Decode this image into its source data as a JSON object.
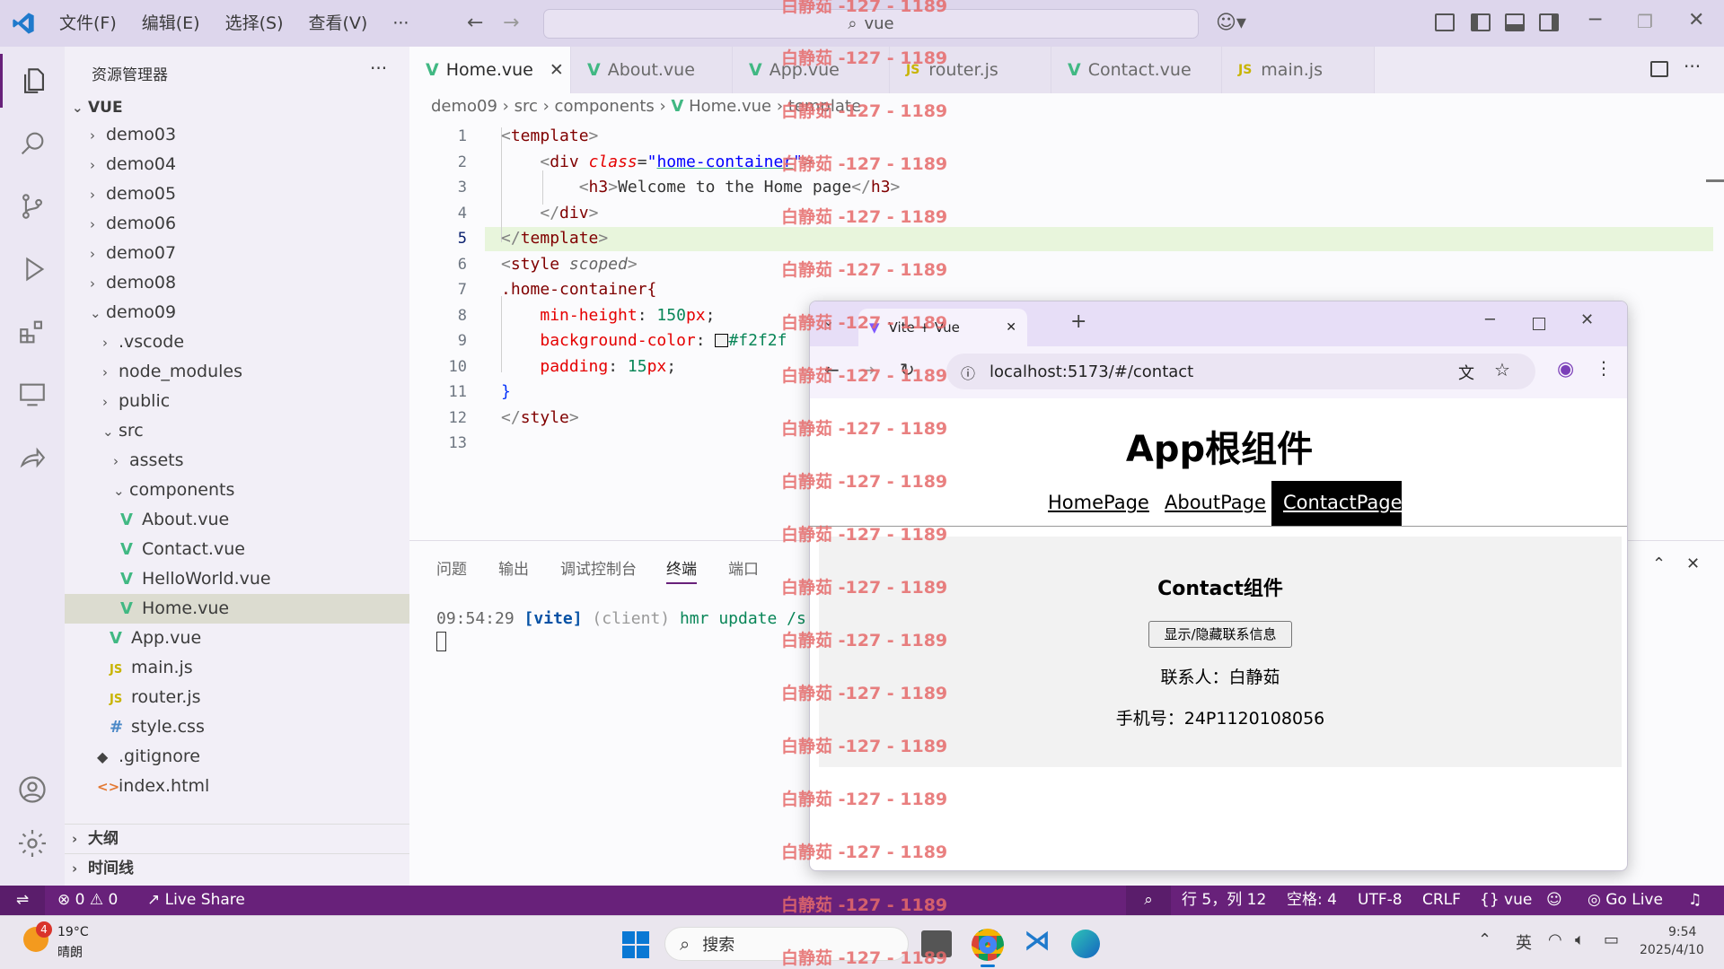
{
  "titlebar": {
    "menus": [
      "文件(F)",
      "编辑(E)",
      "选择(S)",
      "查看(V)",
      "···"
    ],
    "search": "vue"
  },
  "sidebar": {
    "title": "资源管理器",
    "more": "···",
    "root": "VUE",
    "items": [
      {
        "label": "demo03"
      },
      {
        "label": "demo04"
      },
      {
        "label": "demo05"
      },
      {
        "label": "demo06"
      },
      {
        "label": "demo07"
      },
      {
        "label": "demo08"
      },
      {
        "label": "demo09"
      },
      {
        "label": ".vscode"
      },
      {
        "label": "node_modules"
      },
      {
        "label": "public"
      },
      {
        "label": "src"
      },
      {
        "label": "assets"
      },
      {
        "label": "components"
      },
      {
        "label": "About.vue"
      },
      {
        "label": "Contact.vue"
      },
      {
        "label": "HelloWorld.vue"
      },
      {
        "label": "Home.vue"
      },
      {
        "label": "App.vue"
      },
      {
        "label": "main.js"
      },
      {
        "label": "router.js"
      },
      {
        "label": "style.css"
      },
      {
        "label": ".gitignore"
      },
      {
        "label": "index.html"
      }
    ],
    "outline": "大纲",
    "timeline": "时间线"
  },
  "tabs": [
    {
      "label": "Home.vue",
      "kind": "vue"
    },
    {
      "label": "About.vue",
      "kind": "vue"
    },
    {
      "label": "App.vue",
      "kind": "vue"
    },
    {
      "label": "router.js",
      "kind": "js"
    },
    {
      "label": "Contact.vue",
      "kind": "vue"
    },
    {
      "label": "main.js",
      "kind": "js"
    }
  ],
  "breadcrumb": {
    "a": "demo09",
    "b": "src",
    "c": "components",
    "d": "Home.vue",
    "e": "template"
  },
  "code": {
    "line2_class": "home-container",
    "line3_text": "Welcome to the Home page",
    "line7": ".home-container{",
    "line8_prop": "min-height",
    "line8_val": "150",
    "line9_prop": "background-color",
    "line9_val": "#f2f2f",
    "line10_prop": "padding",
    "line10_val": "15"
  },
  "panel": {
    "tabs": [
      "问题",
      "输出",
      "调试控制台",
      "终端",
      "端口"
    ],
    "terminal_time": "09:54:29",
    "terminal_tag": "[vite]",
    "terminal_client": "(client)",
    "terminal_msg": "hmr update /s"
  },
  "browser": {
    "tab_title": "Vite + Vue",
    "url": "localhost:5173/#/contact",
    "app_title": "App根组件",
    "nav": [
      "HomePage",
      "AboutPage",
      "ContactPage"
    ],
    "contact_title": "Contact组件",
    "toggle_button": "显示/隐藏联系信息",
    "contact_person": "联系人：白静茹",
    "phone": "手机号：24P1120108056"
  },
  "statusbar": {
    "errors": "0",
    "warnings": "0",
    "liveshare": "Live Share",
    "position": "行 5，列 12",
    "spaces": "空格: 4",
    "encoding": "UTF-8",
    "eol": "CRLF",
    "lang": "vue",
    "golive": "Go Live"
  },
  "taskbar": {
    "temp": "19°C",
    "weather": "晴朗",
    "badge": "4",
    "search": "搜索",
    "ime": "英",
    "time": "9:54",
    "date": "2025/4/10"
  },
  "watermark": "白静茹 -127 - 1189",
  "colors": {
    "accent": "#68217a",
    "vue": "#41b883",
    "active_nav": "#000000"
  }
}
